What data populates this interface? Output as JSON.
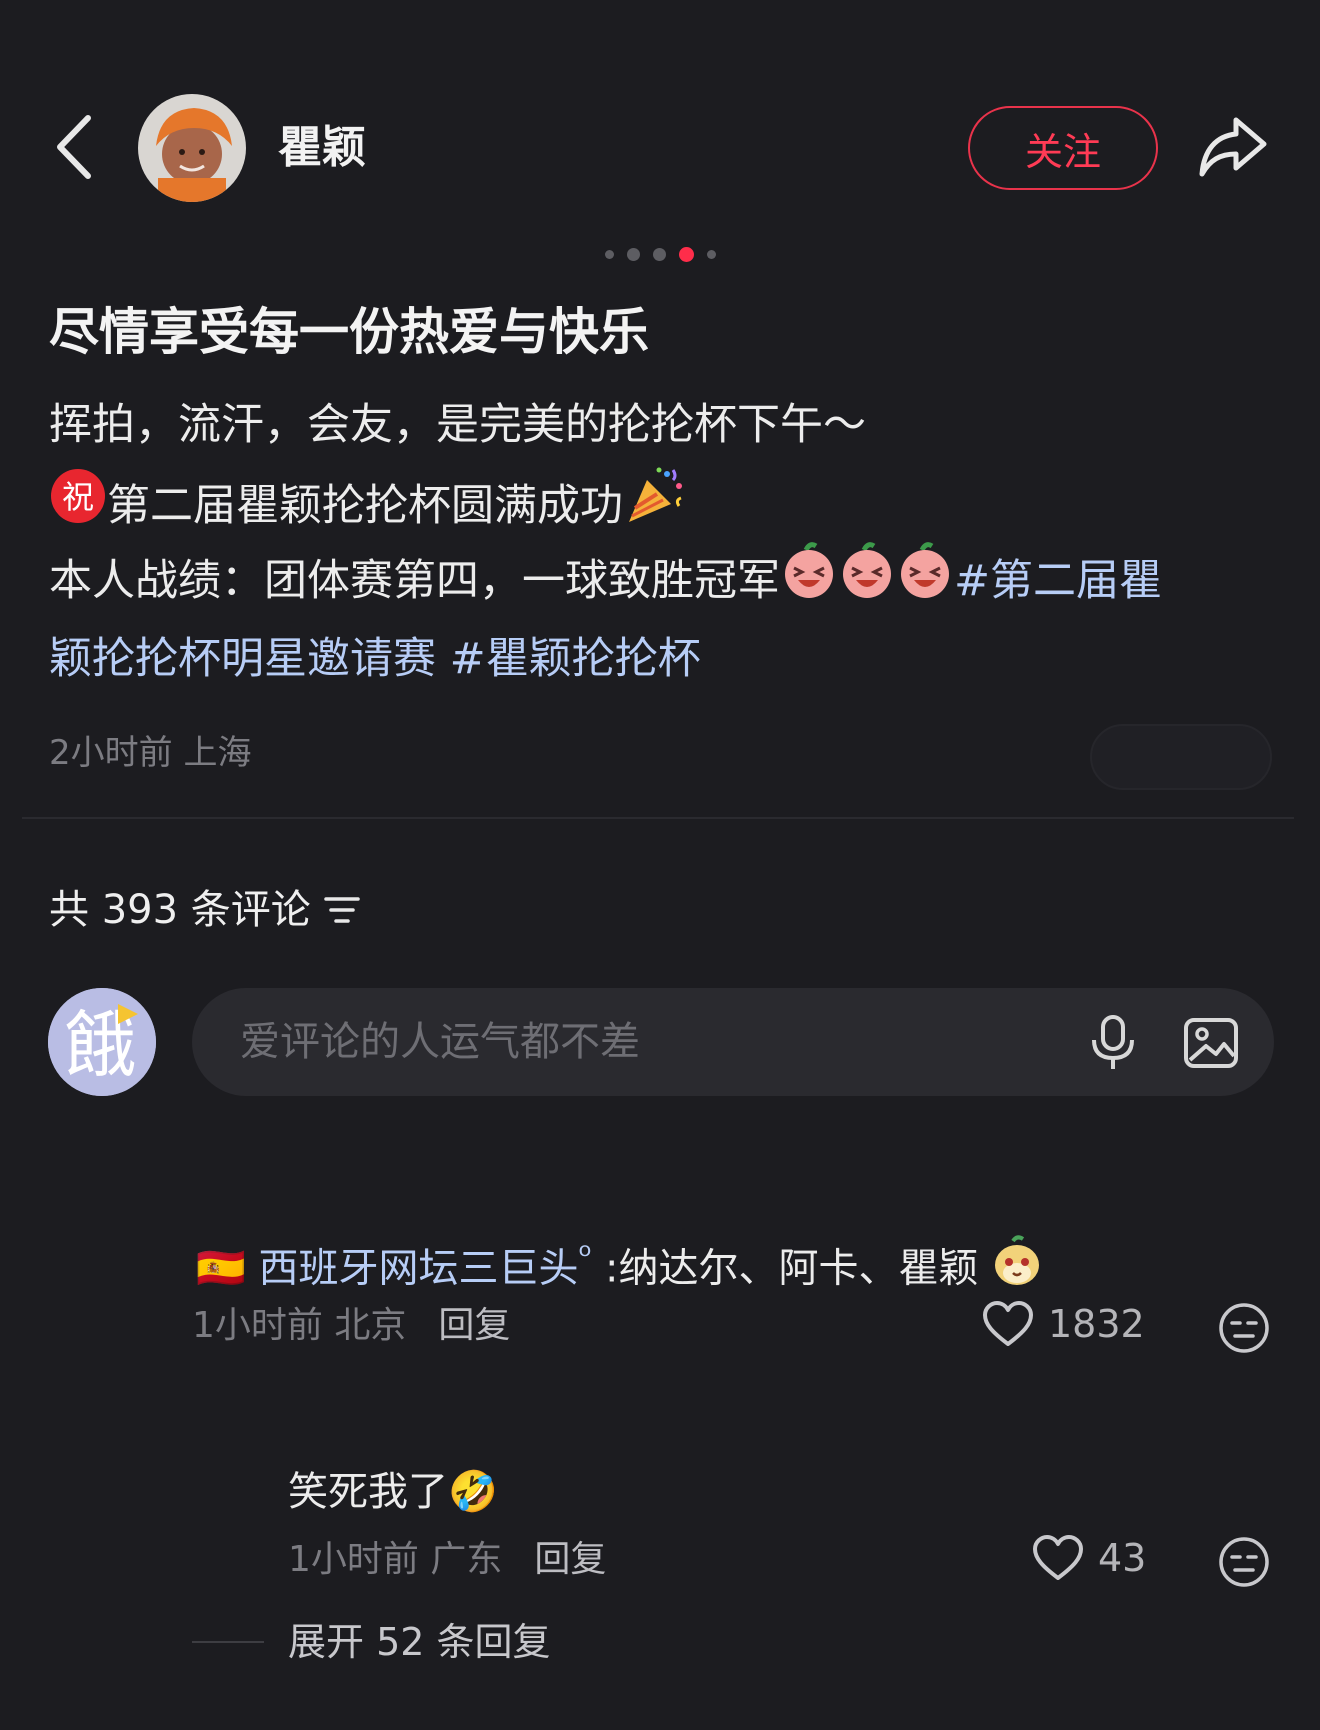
{
  "header": {
    "author_name": "瞿颖",
    "follow_label": "关注",
    "icons": {
      "back": "back-arrow-icon",
      "share": "share-icon"
    },
    "colors": {
      "accent": "#ff3b55",
      "link": "#b7cdf6",
      "background": "#1c1c20"
    }
  },
  "carousel": {
    "total": 5,
    "active_index": 4
  },
  "post": {
    "title": "尽情享受每一份热爱与快乐",
    "line1": "挥拍，流汗，会友，是完美的抡抡杯下午～",
    "line2_badge": "祝",
    "line2_text": "第二届瞿颖抡抡杯圆满成功",
    "line3_text": "本人战绩：团体赛第四，一球致胜冠军",
    "hashtag1_part1": "#第二届瞿",
    "hashtag1_part2": "颖抡抡杯明星邀请赛",
    "hashtag2": "#瞿颖抡抡杯",
    "time_location": "2小时前 上海"
  },
  "comments_section": {
    "count_label": "共 393 条评论",
    "input_placeholder": "爱评论的人运气都不差",
    "my_avatar_char": "餓"
  },
  "comments": [
    {
      "flag": "🇪🇸",
      "user": "西班牙网坛三巨头",
      "search_mark": "ᵒ",
      "text": ":纳达尔、阿卡、瞿颖",
      "time_location": "1小时前 北京",
      "reply_label": "回复",
      "likes": "1832"
    },
    {
      "text": "笑死我了",
      "emoji": "🤣",
      "time_location": "1小时前 广东",
      "reply_label": "回复",
      "likes": "43",
      "expand_label": "展开 52 条回复"
    }
  ]
}
